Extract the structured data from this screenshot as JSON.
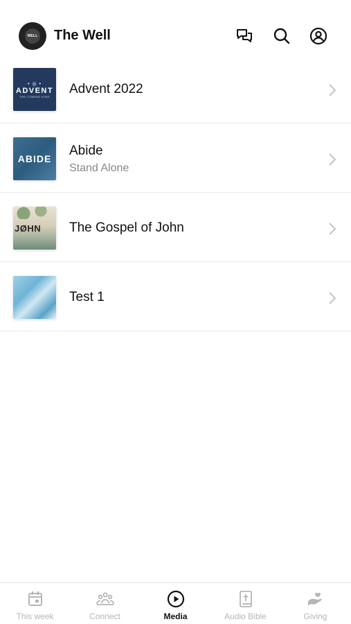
{
  "header": {
    "title": "The Well",
    "logo_text": "WELL",
    "icons": [
      "chat-icon",
      "search-icon",
      "account-icon"
    ]
  },
  "media_list": [
    {
      "title": "Advent 2022",
      "subtitle": "",
      "thumb_text": "ADVENT",
      "thumb_sub": "THE COMING KING"
    },
    {
      "title": "Abide",
      "subtitle": "Stand Alone",
      "thumb_text": "ABIDE",
      "thumb_sub": ""
    },
    {
      "title": "The Gospel of John",
      "subtitle": "",
      "thumb_text": "JØHN",
      "thumb_sub": ""
    },
    {
      "title": "Test 1",
      "subtitle": "",
      "thumb_text": "",
      "thumb_sub": ""
    }
  ],
  "tabs": [
    {
      "label": "This week",
      "icon": "calendar-icon",
      "active": false
    },
    {
      "label": "Connect",
      "icon": "group-icon",
      "active": false
    },
    {
      "label": "Media",
      "icon": "play-icon",
      "active": true
    },
    {
      "label": "Audio Bible",
      "icon": "bible-icon",
      "active": false
    },
    {
      "label": "Giving",
      "icon": "giving-hand-icon",
      "active": false
    }
  ],
  "colors": {
    "active_tab": "#111111",
    "inactive_tab": "#b5b5b5",
    "divider": "#ececec"
  }
}
